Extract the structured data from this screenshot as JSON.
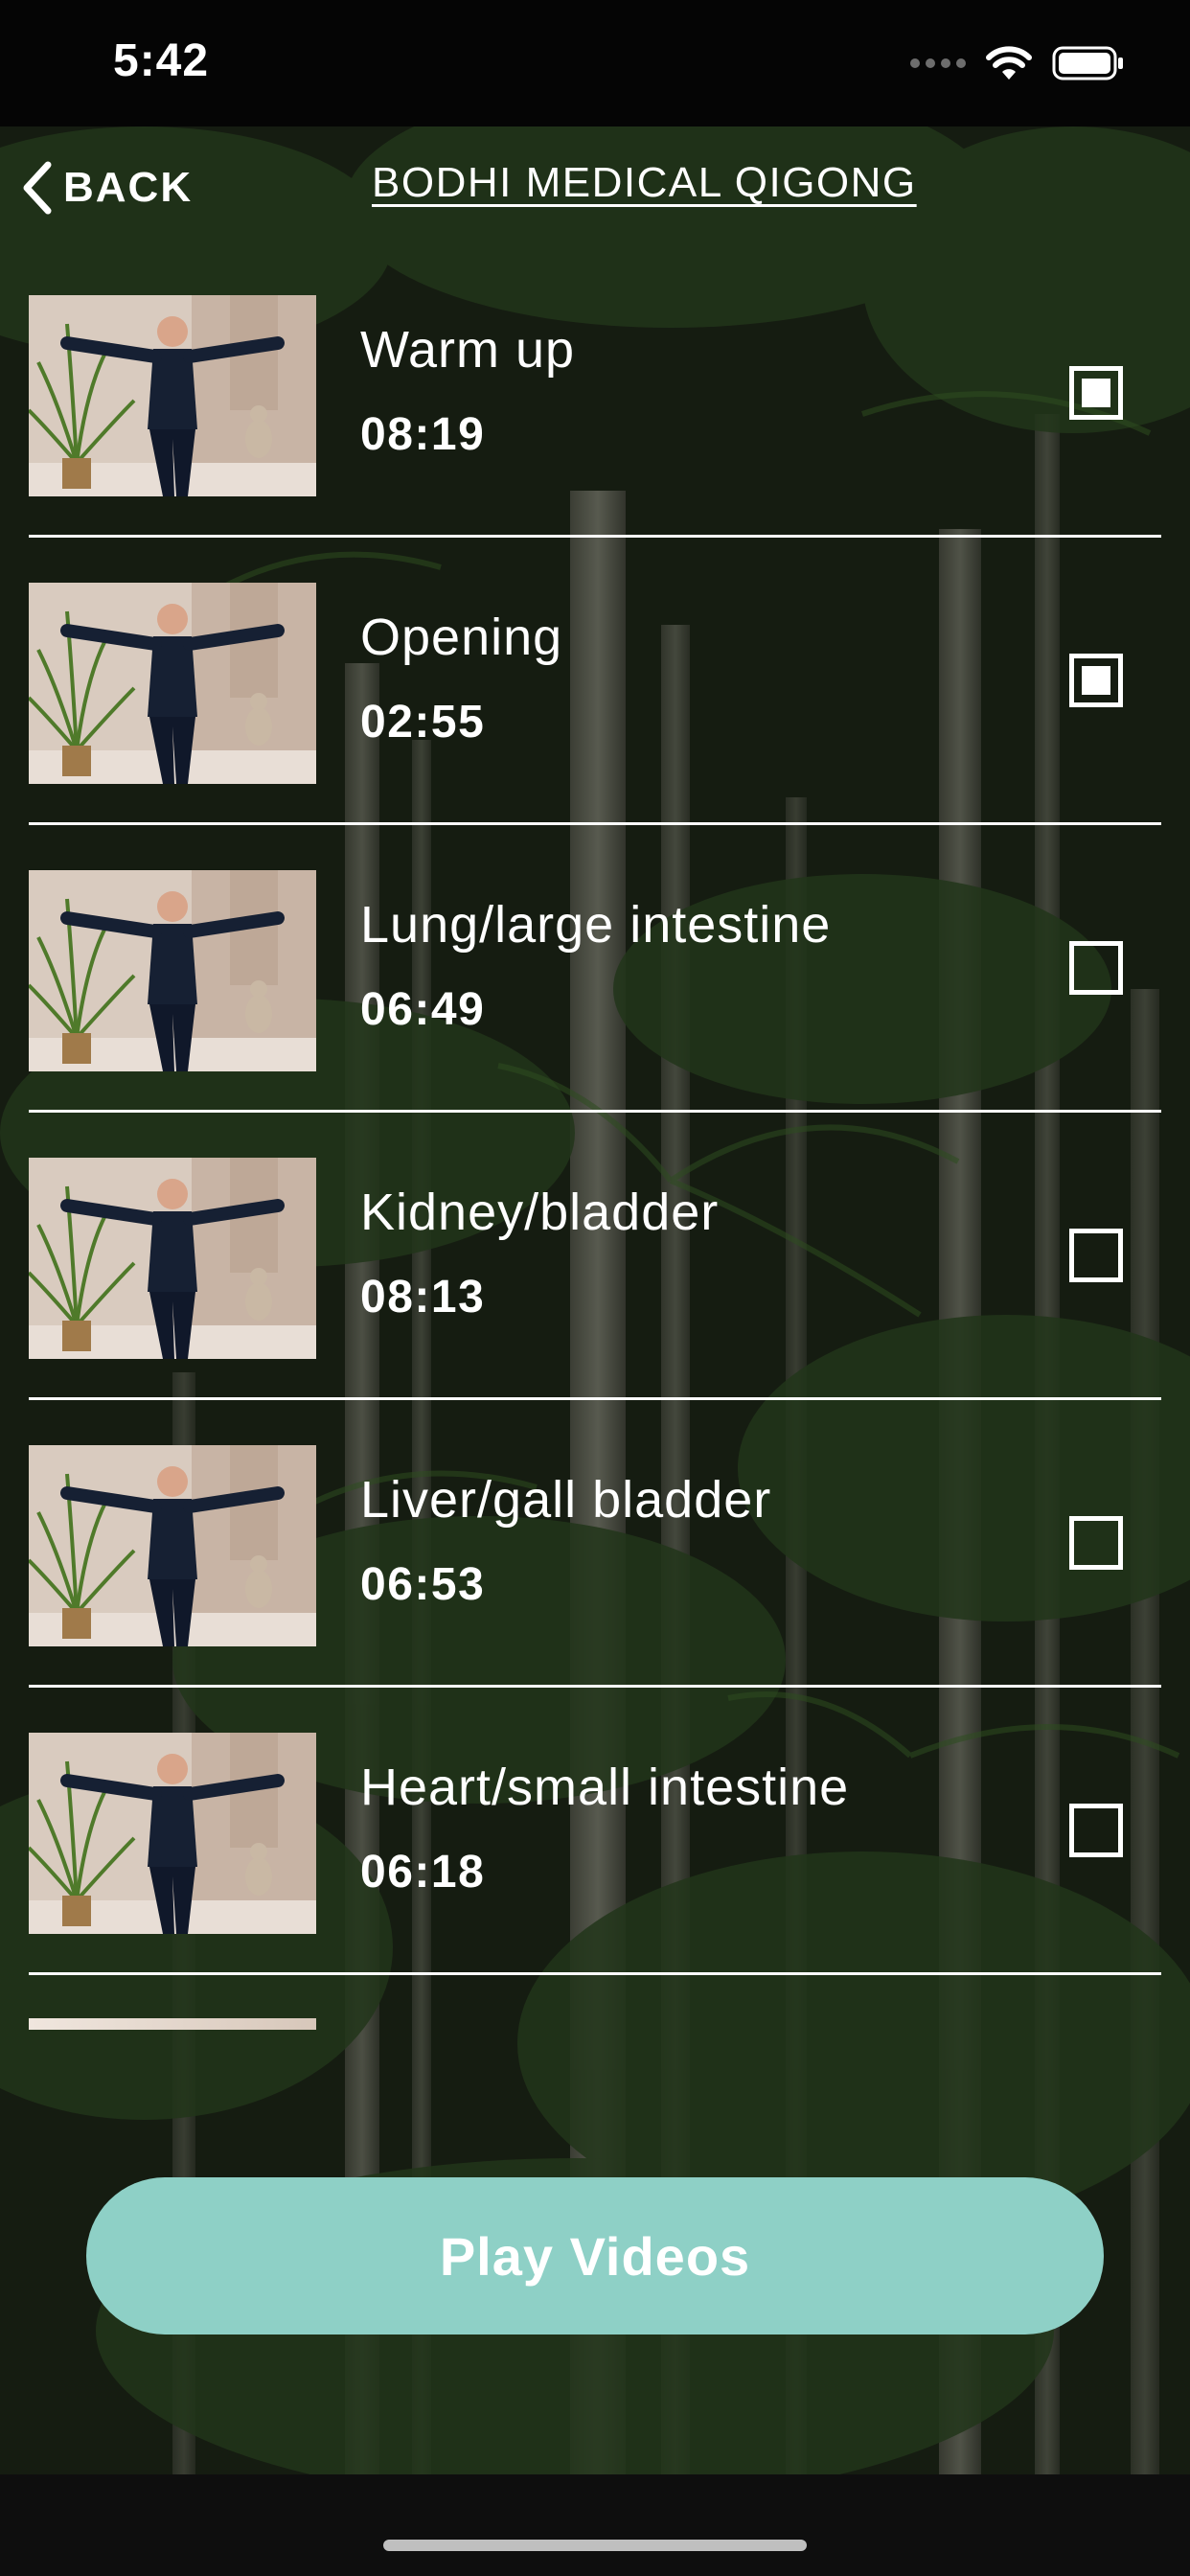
{
  "status_bar": {
    "time": "5:42"
  },
  "header": {
    "back_label": "BACK",
    "title": "BODHI MEDICAL QIGONG"
  },
  "videos": [
    {
      "title": "Warm up",
      "duration": "08:19",
      "checked": true
    },
    {
      "title": "Opening",
      "duration": "02:55",
      "checked": true
    },
    {
      "title": "Lung/large intestine",
      "duration": "06:49",
      "checked": false
    },
    {
      "title": "Kidney/bladder",
      "duration": "08:13",
      "checked": false
    },
    {
      "title": "Liver/gall bladder",
      "duration": "06:53",
      "checked": false
    },
    {
      "title": "Heart/small intestine",
      "duration": "06:18",
      "checked": false
    }
  ],
  "play_button": {
    "label": "Play Videos"
  },
  "colors": {
    "accent": "#8ed0c6",
    "background": "#1f2a1a",
    "text": "#ffffff"
  },
  "icons": {
    "back": "chevron-left-icon",
    "wifi": "wifi-icon",
    "battery": "battery-icon",
    "signal": "signal-dots-icon"
  }
}
